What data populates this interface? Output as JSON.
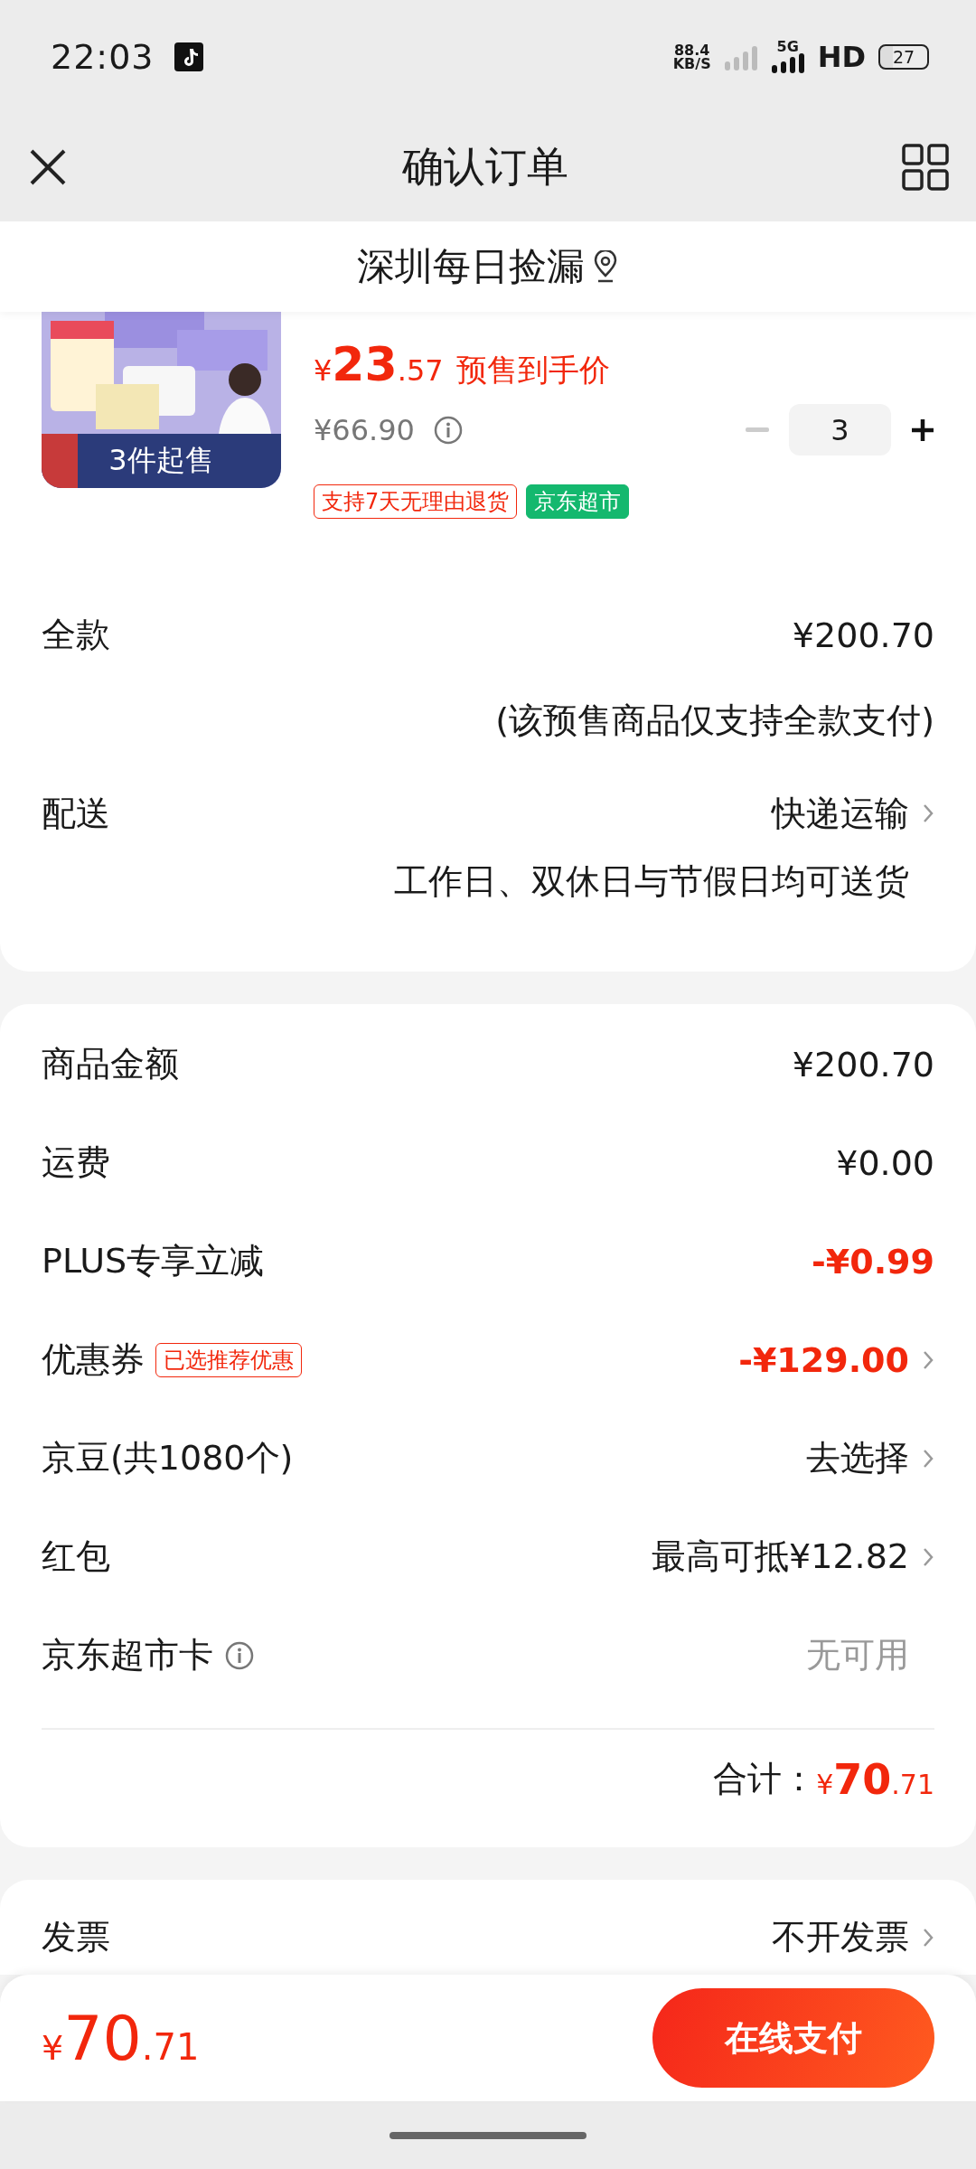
{
  "status_bar": {
    "time": "22:03",
    "speed_value": "88.4",
    "speed_unit": "KB/S",
    "network": "5G",
    "hd": "HD",
    "battery": "27"
  },
  "nav": {
    "title": "确认订单"
  },
  "store": {
    "name": "深圳每日捡漏"
  },
  "product": {
    "badge": "3件起售",
    "currency": "¥",
    "price_int": "23",
    "price_dec": ".57",
    "price_label": "预售到手价",
    "original_price": "¥66.90",
    "quantity": "3",
    "decrement_disabled": true,
    "tags": [
      {
        "text": "支持7天无理由退货",
        "kind": "outline"
      },
      {
        "text": "京东超市",
        "kind": "filled"
      }
    ]
  },
  "payment": {
    "label": "全款",
    "value": "¥200.70",
    "note": "(该预售商品仅支持全款支付)"
  },
  "delivery": {
    "label": "配送",
    "method": "快递运输",
    "note": "工作日、双休日与节假日均可送货"
  },
  "summary": {
    "rows": [
      {
        "label": "商品金额",
        "value": "¥200.70",
        "kind": "amount",
        "arrow": false
      },
      {
        "label": "运费",
        "value": "¥0.00",
        "kind": "amount",
        "arrow": false
      },
      {
        "label": "PLUS专享立减",
        "value": "-¥0.99",
        "kind": "discount",
        "arrow": false
      },
      {
        "label": "优惠券",
        "badge": "已选推荐优惠",
        "value": "-¥129.00",
        "kind": "discount",
        "arrow": true
      },
      {
        "label": "京豆(共1080个)",
        "value": "去选择",
        "kind": "action",
        "arrow": true
      },
      {
        "label": "红包",
        "value": "最高可抵¥12.82",
        "kind": "action",
        "arrow": true
      },
      {
        "label": "京东超市卡",
        "value": "无可用",
        "kind": "unavailable",
        "arrow": false,
        "info_icon": true
      }
    ],
    "total_label": "合计：",
    "total_currency": "¥",
    "total_int": "70",
    "total_dec": ".71"
  },
  "invoice": {
    "label": "发票",
    "value": "不开发票"
  },
  "footer": {
    "currency": "¥",
    "total_int": "70",
    "total_dec": ".71",
    "pay_button": "在线支付"
  }
}
